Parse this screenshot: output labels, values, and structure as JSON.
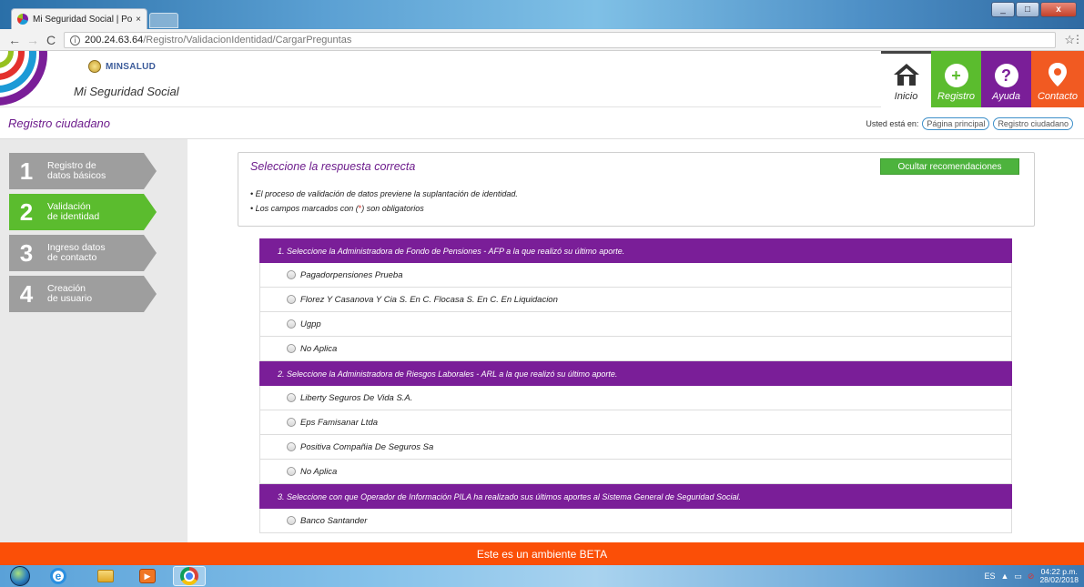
{
  "browser": {
    "tab_title": "Mi Seguridad Social | Po",
    "tab_close": "×",
    "url_host": "200.24.63.64",
    "url_path": "/Registro/ValidacionIdentidad/CargarPreguntas",
    "win_min": "_",
    "win_max": "□",
    "win_close": "x"
  },
  "header": {
    "ministry": "MINSALUD",
    "brand": "Mi Seguridad Social",
    "nav": [
      {
        "label": "Inicio"
      },
      {
        "label": "Registro"
      },
      {
        "label": "Ayuda"
      },
      {
        "label": "Contacto"
      }
    ]
  },
  "page": {
    "title": "Registro ciudadano",
    "breadcrumb_prefix": "Usted está en:",
    "breadcrumbs": [
      "Página principal",
      "Registro ciudadano"
    ]
  },
  "steps": [
    {
      "num": "1",
      "line1": "Registro de",
      "line2": "datos básicos"
    },
    {
      "num": "2",
      "line1": "Validación",
      "line2": "de identidad"
    },
    {
      "num": "3",
      "line1": "Ingreso datos",
      "line2": "de contacto"
    },
    {
      "num": "4",
      "line1": "Creación",
      "line2": "de usuario"
    }
  ],
  "intro": {
    "heading": "Seleccione la respuesta correcta",
    "button": "Ocultar recomendaciones",
    "line1": "• El proceso de validación de datos previene la suplantación de identidad.",
    "line2_a": "• Los campos marcados con (",
    "line2_req": "*",
    "line2_b": ") son obligatorios"
  },
  "questions": [
    {
      "text": "1. Seleccione la Administradora de Fondo de Pensiones - AFP a la que realizó su último aporte.",
      "options": [
        "Pagadorpensiones Prueba",
        "Florez Y Casanova Y Cia S. En C. Flocasa S. En C. En Liquidacion",
        "Ugpp",
        "No Aplica"
      ]
    },
    {
      "text": "2. Seleccione la Administradora de Riesgos Laborales - ARL a la que realizó su último aporte.",
      "options": [
        "Liberty Seguros De Vida S.A.",
        "Eps Famisanar Ltda",
        "Positiva Compañia De Seguros Sa",
        "No Aplica"
      ]
    },
    {
      "text": "3. Seleccione con que Operador de Información PILA ha realizado sus últimos aportes al Sistema General de Seguridad Social.",
      "options": [
        "Banco Santander"
      ]
    }
  ],
  "beta_banner": "Este es un ambiente BETA",
  "taskbar": {
    "lang": "ES",
    "time": "04:22 p.m.",
    "date": "28/02/2018"
  },
  "colors": {
    "purple": "#7a1e98",
    "green": "#5bbc2e",
    "orange": "#fb4f07"
  }
}
